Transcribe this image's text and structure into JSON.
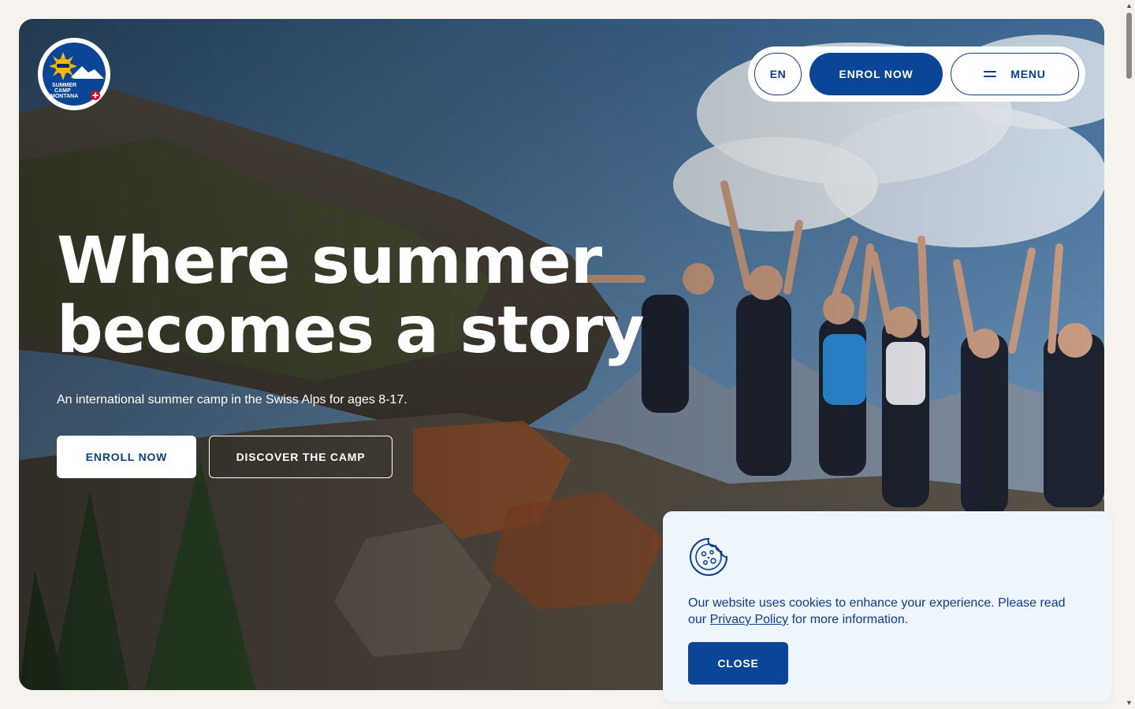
{
  "logo": {
    "line1": "SUMMER",
    "line2": "CAMP",
    "line3": "MONTANA"
  },
  "nav": {
    "language": "EN",
    "enrol_label": "ENROL NOW",
    "menu_label": "MENU"
  },
  "hero": {
    "headline_line1": "Where summer",
    "headline_line2": "becomes a story",
    "subline": "An international summer camp in the Swiss Alps for ages 8-17.",
    "enroll_label": "ENROLL NOW",
    "discover_label": "DISCOVER THE CAMP"
  },
  "cookie": {
    "text_before": "Our website uses cookies to enhance your experience. Please read our ",
    "link_label": "Privacy Policy",
    "text_after": " for more information.",
    "close_label": "CLOSE"
  },
  "colors": {
    "brand_blue": "#0b4597",
    "cookie_bg": "#eef5fd",
    "page_bg": "#f6f3ef",
    "logo_sun": "#f5b800",
    "swiss_red": "#e30613"
  },
  "icons": {
    "menu": "hamburger-icon",
    "cookie": "cookie-icon",
    "logo": "sun-mountain-logo"
  }
}
